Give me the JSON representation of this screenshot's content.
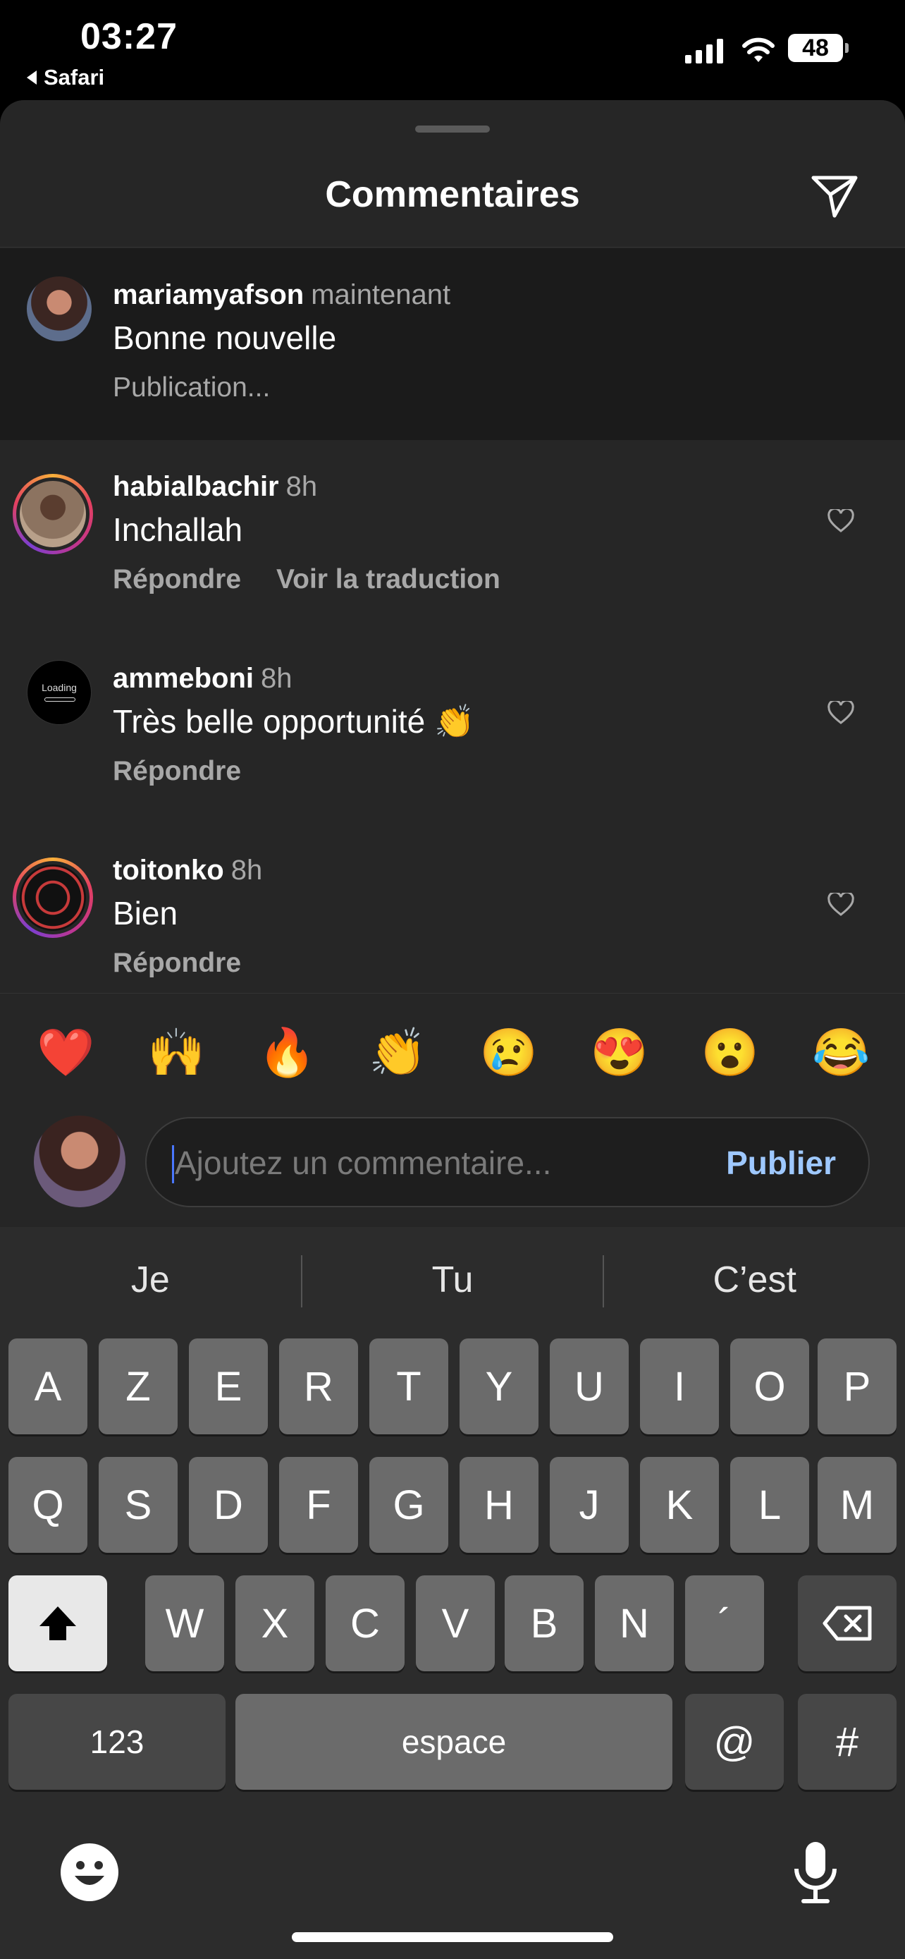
{
  "status_bar": {
    "time": "03:27",
    "back_app": "Safari",
    "battery": "48"
  },
  "sheet": {
    "title": "Commentaires",
    "send_icon": "send-icon"
  },
  "comments": [
    {
      "user": "mariamyafson",
      "time": "maintenant",
      "text": "Bonne nouvelle",
      "status": "Publication...",
      "own": true
    },
    {
      "user": "habialbachir",
      "time": "8h",
      "text": "Inchallah",
      "reply": "Répondre",
      "translate": "Voir la traduction"
    },
    {
      "user": "ammeboni",
      "time": "8h",
      "text": "Très belle opportunité 👏",
      "reply": "Répondre",
      "avatar_text": "Loading"
    },
    {
      "user": "toitonko",
      "time": "8h",
      "text": "Bien",
      "reply": "Répondre"
    }
  ],
  "quick_reactions": [
    "❤️",
    "🙌",
    "🔥",
    "👏",
    "😢",
    "😍",
    "😮",
    "😂"
  ],
  "composer": {
    "placeholder": "Ajoutez un commentaire...",
    "publish": "Publier"
  },
  "keyboard": {
    "suggestions": [
      "Je",
      "Tu",
      "C’est"
    ],
    "row1": [
      "A",
      "Z",
      "E",
      "R",
      "T",
      "Y",
      "U",
      "I",
      "O",
      "P"
    ],
    "row2": [
      "Q",
      "S",
      "D",
      "F",
      "G",
      "H",
      "J",
      "K",
      "L",
      "M"
    ],
    "row3": [
      "W",
      "X",
      "C",
      "V",
      "B",
      "N",
      "´"
    ],
    "numbers": "123",
    "space": "espace",
    "at": "@",
    "hash": "#"
  }
}
